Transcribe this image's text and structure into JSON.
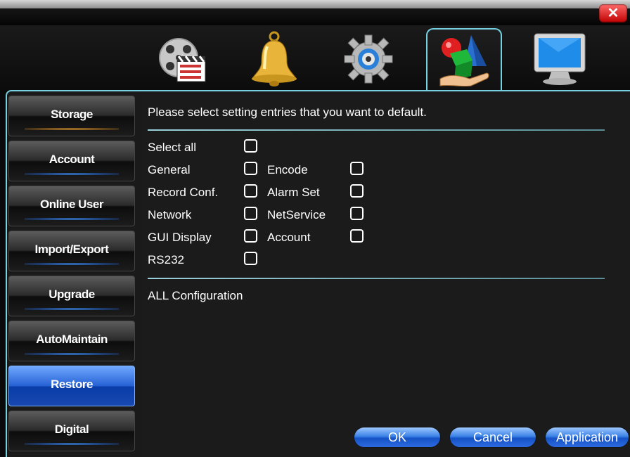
{
  "window": {
    "close_glyph": "✕"
  },
  "tabs": [
    {
      "name": "record-tab",
      "icon": "film-clapboard-icon",
      "active": false
    },
    {
      "name": "alarm-tab",
      "icon": "bell-icon",
      "active": false
    },
    {
      "name": "system-tab",
      "icon": "gear-icon",
      "active": false
    },
    {
      "name": "advanced-tab",
      "icon": "shapes-hand-icon",
      "active": true
    },
    {
      "name": "info-tab",
      "icon": "monitor-icon",
      "active": false
    }
  ],
  "sidebar": {
    "items": [
      {
        "label": "Storage"
      },
      {
        "label": "Account"
      },
      {
        "label": "Online User"
      },
      {
        "label": "Import/Export"
      },
      {
        "label": "Upgrade"
      },
      {
        "label": "AutoMaintain"
      },
      {
        "label": "Restore",
        "active": true
      },
      {
        "label": "Digital"
      }
    ]
  },
  "content": {
    "header": "Please select setting entries that you want to default.",
    "select_all": "Select all",
    "options": {
      "general": "General",
      "encode": "Encode",
      "record_conf": "Record Conf.",
      "alarm_set": "Alarm Set",
      "network": "Network",
      "netservice": "NetService",
      "gui_display": "GUI Display",
      "account": "Account",
      "rs232": "RS232"
    },
    "all_config": "ALL Configuration"
  },
  "buttons": {
    "ok": "OK",
    "cancel": "Cancel",
    "application": "Application"
  },
  "colors": {
    "accent": "#76d0df",
    "button_blue": "#2d6ae0",
    "active_side": "#2661d4"
  }
}
